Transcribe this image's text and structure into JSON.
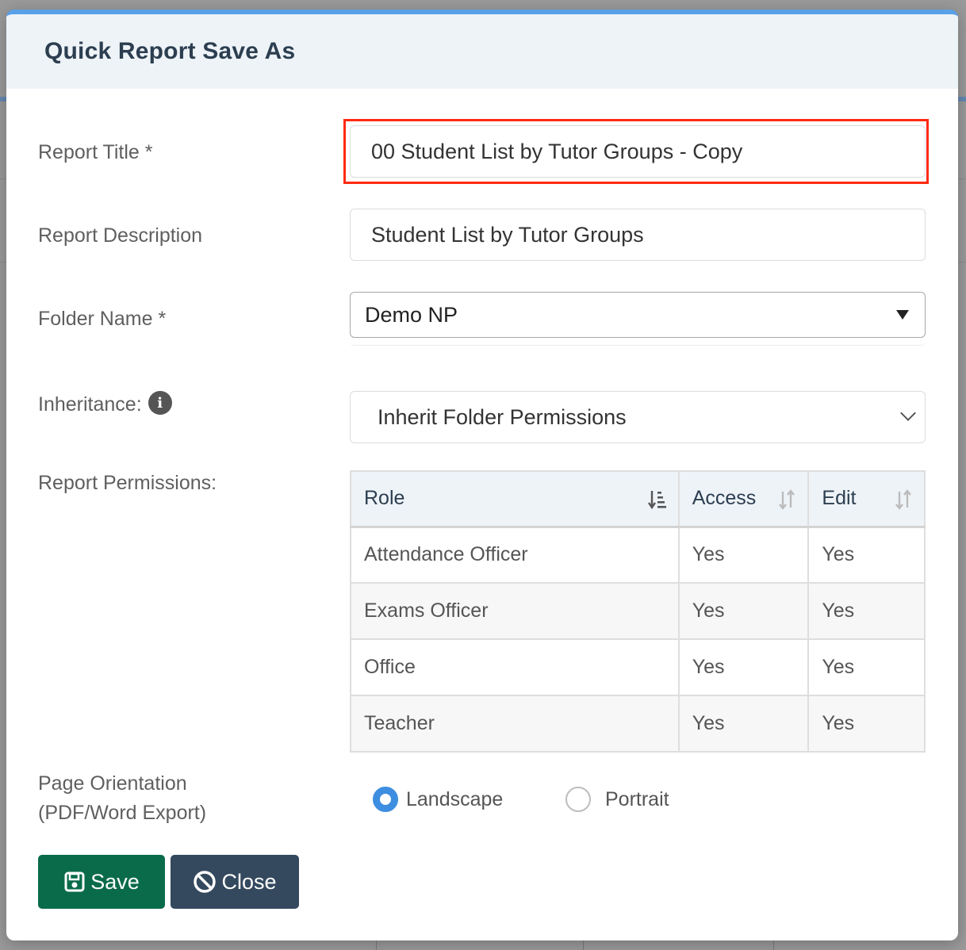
{
  "modal": {
    "title": "Quick Report Save As"
  },
  "form": {
    "report_title": {
      "label": "Report Title *",
      "value": "00 Student List by Tutor Groups - Copy"
    },
    "report_description": {
      "label": "Report Description",
      "value": "Student List by Tutor Groups"
    },
    "folder_name": {
      "label": "Folder Name *",
      "selected": "Demo NP"
    },
    "inheritance": {
      "label": "Inheritance:",
      "selected": "Inherit Folder Permissions"
    },
    "report_permissions": {
      "label": "Report Permissions:",
      "columns": [
        "Role",
        "Access",
        "Edit"
      ],
      "rows": [
        {
          "role": "Attendance Officer",
          "access": "Yes",
          "edit": "Yes"
        },
        {
          "role": "Exams Officer",
          "access": "Yes",
          "edit": "Yes"
        },
        {
          "role": "Office",
          "access": "Yes",
          "edit": "Yes"
        },
        {
          "role": "Teacher",
          "access": "Yes",
          "edit": "Yes"
        }
      ]
    },
    "page_orientation": {
      "label_line1": "Page Orientation",
      "label_line2": "(PDF/Word Export)",
      "options": [
        "Landscape",
        "Portrait"
      ],
      "selected": "Landscape"
    }
  },
  "buttons": {
    "save_label": "Save",
    "close_label": "Close"
  },
  "colors": {
    "highlight": "#ff2a12",
    "save_bg": "#0a6b4b",
    "close_bg": "#34495e",
    "radio_accent": "#3d8ee0",
    "header_bg": "#eef3f8"
  },
  "icons": {
    "info": "info-icon",
    "sort_active": "sort-amount-down-icon",
    "sort_idle": "sort-icon",
    "caret": "caret-down-icon",
    "chevron": "chevron-down-icon",
    "save": "floppy-disk-icon",
    "close": "ban-icon"
  }
}
